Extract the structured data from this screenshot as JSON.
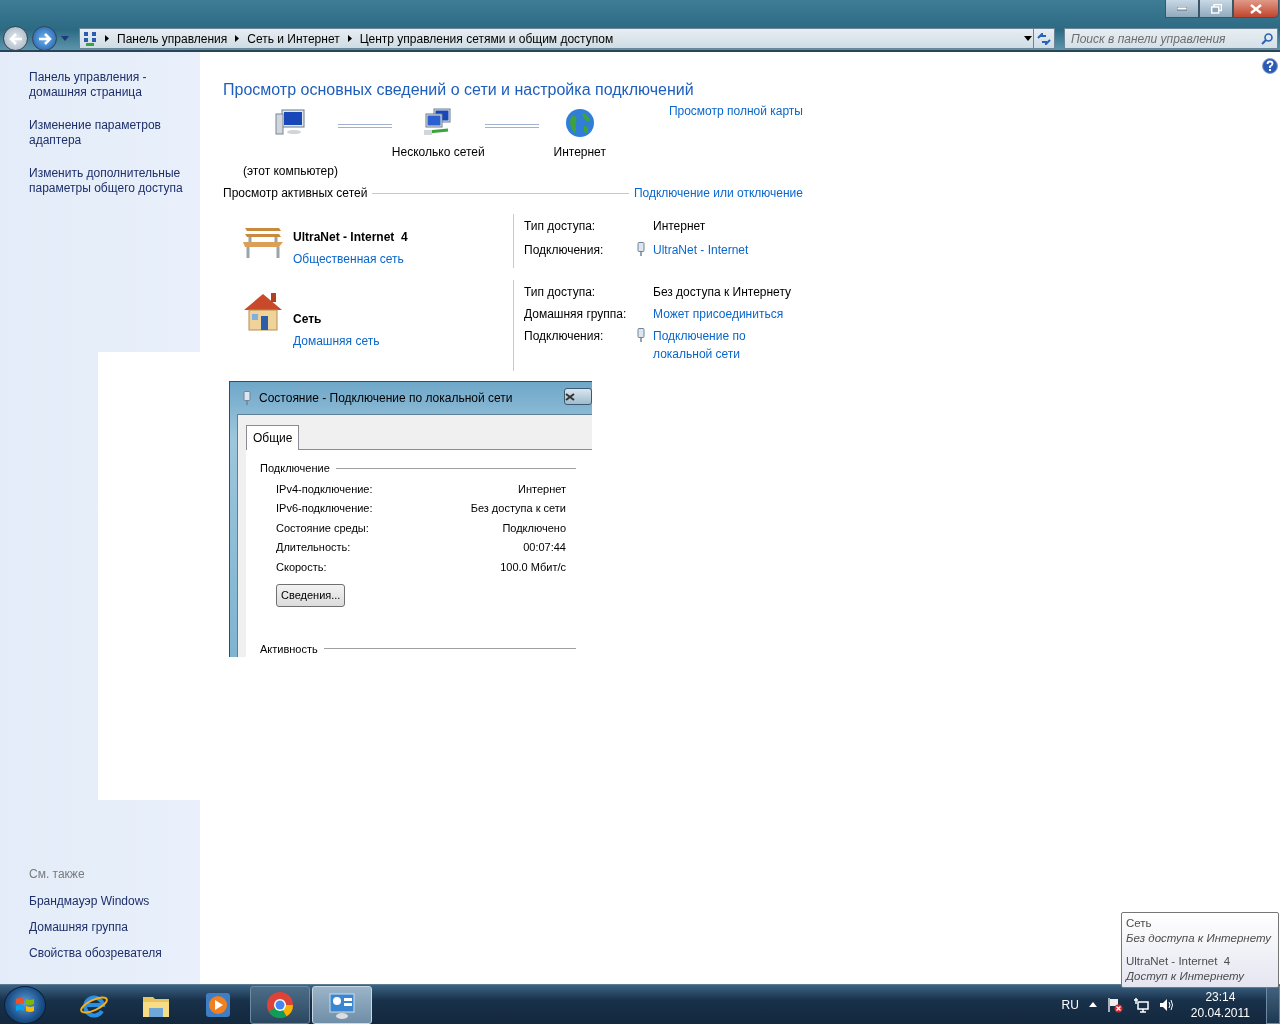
{
  "window": {
    "buttons": [
      {
        "kind": "minimize"
      },
      {
        "kind": "restore"
      },
      {
        "kind": "close"
      }
    ]
  },
  "address_bar": {
    "breadcrumbs": [
      "Панель управления",
      "Сеть и Интернет",
      "Центр управления сетями и общим доступом"
    ],
    "search": {
      "placeholder": "Поиск в панели управления"
    }
  },
  "sidebar": {
    "links": [
      "Панель управления - домашняя страница",
      "Изменение параметров адаптера",
      "Изменить дополнительные параметры общего доступа"
    ],
    "see_also": {
      "title": "См. также",
      "links": [
        "Брандмауэр Windows",
        "Домашняя группа",
        "Свойства обозревателя"
      ]
    }
  },
  "main": {
    "title": "Просмотр основных сведений о сети и настройка подключений",
    "map": {
      "nodes": [
        {
          "kind": "computer",
          "label": "(этот компьютер)"
        },
        {
          "kind": "networks",
          "label": "Несколько сетей"
        },
        {
          "kind": "internet",
          "label": "Интернет"
        }
      ],
      "full_map_link": "Просмотр полной карты"
    },
    "active_networks": {
      "title": "Просмотр активных сетей",
      "link": "Подключение или отключение",
      "networks": [
        {
          "kind": "public",
          "name": "UltraNet - Internet  4",
          "type_link": "Общественная сеть",
          "details": [
            {
              "label": "Тип доступа:",
              "value": "Интернет",
              "kind": "text"
            },
            {
              "label": "Подключения:",
              "value": "UltraNet - Internet",
              "kind": "connection"
            }
          ]
        },
        {
          "kind": "home",
          "name": "Сеть",
          "type_link": "Домашняя сеть",
          "details": [
            {
              "label": "Тип доступа:",
              "value": "Без доступа к Интернету",
              "kind": "text"
            },
            {
              "label": "Домашняя группа:",
              "value": "Может присоединиться",
              "kind": "link"
            },
            {
              "label": "Подключения:",
              "value": "Подключение по локальной сети",
              "kind": "connection"
            }
          ]
        }
      ]
    }
  },
  "status_dialog": {
    "title": "Состояние - Подключение по локальной сети",
    "tabs": [
      {
        "label": "Общие",
        "selected": true
      }
    ],
    "section": "Подключение",
    "rows": [
      {
        "label": "IPv4-подключение:",
        "value": "Интернет"
      },
      {
        "label": "IPv6-подключение:",
        "value": "Без доступа к сети"
      },
      {
        "label": "Состояние среды:",
        "value": "Подключено"
      },
      {
        "label": "Длительность:",
        "value": "00:07:44"
      },
      {
        "label": "Скорость:",
        "value": "100.0 Мбит/с"
      }
    ],
    "button": "Сведения...",
    "section_2": "Активность"
  },
  "tooltip": {
    "entries": [
      {
        "name": "Сеть",
        "status": "Без доступа к Интернету"
      },
      {
        "name": "UltraNet - Internet  4",
        "status": "Доступ к Интернету"
      }
    ]
  },
  "taskbar": {
    "apps": [
      {
        "kind": "ie",
        "running": false,
        "selected": false
      },
      {
        "kind": "explorer",
        "running": false,
        "selected": false
      },
      {
        "kind": "media",
        "running": false,
        "selected": false
      },
      {
        "kind": "chrome",
        "running": true,
        "selected": false
      },
      {
        "kind": "control",
        "running": true,
        "selected": true
      }
    ],
    "language": "RU",
    "time": "23:14",
    "date": "20.04.2011"
  }
}
